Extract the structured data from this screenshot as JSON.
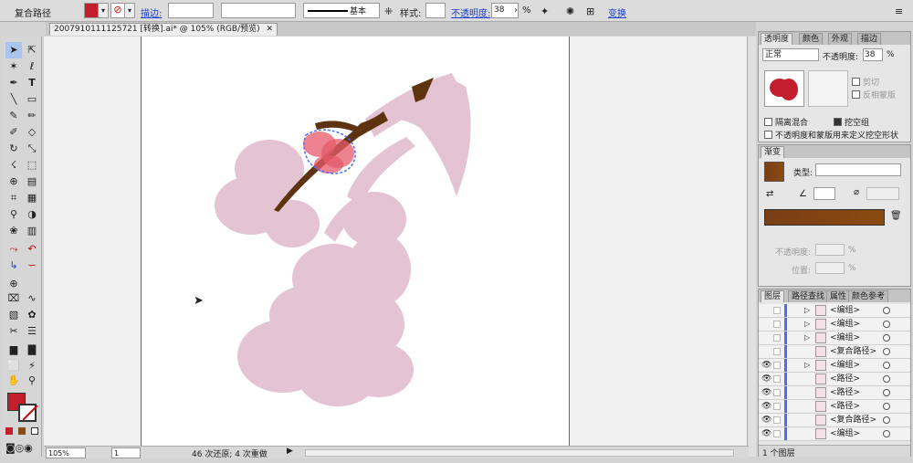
{
  "top_bar": {
    "object_type": "复合路径",
    "stroke_label": "描边:",
    "stroke_style": "基本",
    "style_label": "样式:",
    "opacity_label": "不透明度:",
    "opacity_value": "38",
    "percent": "%",
    "transform_label": "变换",
    "fill_color": "#c21e2e"
  },
  "document": {
    "tab_title": "2007910111125721 [转换].ai* @ 105% (RGB/预览)",
    "close_glyph": "✕"
  },
  "status_bar": {
    "zoom": "105%",
    "artboard": "1",
    "history": "46 次还原; 4 次重做"
  },
  "toolbox": {
    "fill_color": "#c21e2e",
    "tools": [
      "selection-tool",
      "direct-selection-tool",
      "magic-wand-tool",
      "lasso-tool",
      "pen-tool",
      "type-tool",
      "line-tool",
      "rectangle-tool",
      "paintbrush-tool",
      "pencil-tool",
      "blob-brush-tool",
      "eraser-tool",
      "rotate-tool",
      "scale-tool",
      "warp-tool",
      "free-transform-tool",
      "shape-builder-tool",
      "perspective-tool",
      "mesh-tool",
      "gradient-tool",
      "eyedropper-tool",
      "blend-tool",
      "symbol-sprayer-tool",
      "column-graph-tool",
      "artboard-tool",
      "slice-tool",
      "hand-tool",
      "zoom-tool"
    ]
  },
  "transparency_panel": {
    "tabs": [
      "透明度",
      "颜色",
      "外观",
      "描边"
    ],
    "blend_mode": "正常",
    "opacity_label": "不透明度:",
    "opacity_value": "38",
    "percent": "%",
    "clip_label": "剪切",
    "invert_mask_label": "反相蒙版",
    "isolate_label": "隔离混合",
    "knockout_label": "挖空组",
    "knockout_checked": true,
    "define_shape_label": "不透明度和蒙版用来定义挖空形状"
  },
  "gradient_panel": {
    "tab": "渐变",
    "type_label": "类型:",
    "type_value": "",
    "opacity_label": "不透明度:",
    "location_label": "位置:",
    "percent": "%",
    "start_color": "#7a3e16",
    "end_color": "#8b4a10"
  },
  "layers_panel": {
    "tabs": [
      "图层",
      "路径查找",
      "属性",
      "颜色参考"
    ],
    "rows": [
      {
        "name": "<编组>",
        "eye": false,
        "expand": true
      },
      {
        "name": "<编组>",
        "eye": false,
        "expand": true
      },
      {
        "name": "<编组>",
        "eye": false,
        "expand": true
      },
      {
        "name": "<复合路径>",
        "eye": false,
        "expand": false
      },
      {
        "name": "<编组>",
        "eye": true,
        "expand": true
      },
      {
        "name": "<路径>",
        "eye": true,
        "expand": false
      },
      {
        "name": "<路径>",
        "eye": true,
        "expand": false
      },
      {
        "name": "<路径>",
        "eye": true,
        "expand": false
      },
      {
        "name": "<复合路径>",
        "eye": true,
        "expand": false
      },
      {
        "name": "<编组>",
        "eye": true,
        "expand": false
      }
    ],
    "footer": "1 个图层"
  },
  "colors": {
    "petal_pink": "#e4c3d3",
    "branch_brown": "#5e3410",
    "flower_red": "#e55a6a",
    "selection_blue": "#4d6cff"
  }
}
